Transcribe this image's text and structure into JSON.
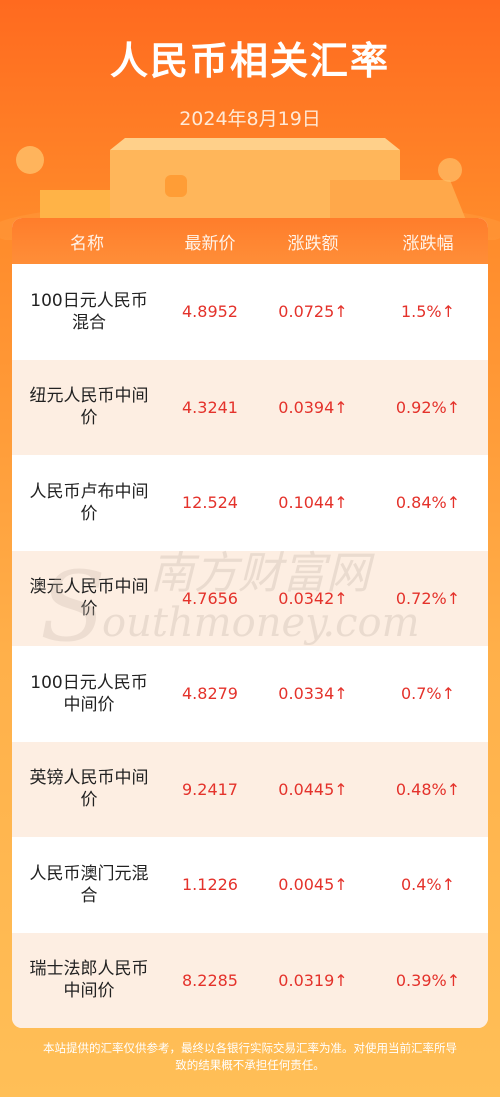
{
  "header": {
    "title": "人民币相关汇率",
    "date": "2024年8月19日"
  },
  "table": {
    "columns": [
      "名称",
      "最新价",
      "涨跌额",
      "涨跌幅"
    ],
    "rows": [
      {
        "name_line1": "100日元人民币",
        "name_line2": "混合",
        "price": "4.8952",
        "change": "0.0725↑",
        "pct": "1.5%↑"
      },
      {
        "name_line1": "纽元人民币中间",
        "name_line2": "价",
        "price": "4.3241",
        "change": "0.0394↑",
        "pct": "0.92%↑"
      },
      {
        "name_line1": "人民币卢布中间",
        "name_line2": "价",
        "price": "12.524",
        "change": "0.1044↑",
        "pct": "0.84%↑"
      },
      {
        "name_line1": "澳元人民币中间",
        "name_line2": "价",
        "price": "4.7656",
        "change": "0.0342↑",
        "pct": "0.72%↑"
      },
      {
        "name_line1": "100日元人民币",
        "name_line2": "中间价",
        "price": "4.8279",
        "change": "0.0334↑",
        "pct": "0.7%↑"
      },
      {
        "name_line1": "英镑人民币中间",
        "name_line2": "价",
        "price": "9.2417",
        "change": "0.0445↑",
        "pct": "0.48%↑"
      },
      {
        "name_line1": "人民币澳门元混",
        "name_line2": "合",
        "price": "1.1226",
        "change": "0.0045↑",
        "pct": "0.4%↑"
      },
      {
        "name_line1": "瑞士法郎人民币",
        "name_line2": "中间价",
        "price": "8.2285",
        "change": "0.0319↑",
        "pct": "0.39%↑"
      }
    ]
  },
  "watermark": {
    "cn": "南方财富网",
    "en": "outhmoney.com"
  },
  "disclaimer": {
    "line1": "本站提供的汇率仅供参考，最终以各银行实际交易汇率为准。对使用当前汇率所导",
    "line2": "致的结果概不承担任何责任。"
  },
  "colors": {
    "accent": "#ff7d2b",
    "up": "#e4322b"
  }
}
